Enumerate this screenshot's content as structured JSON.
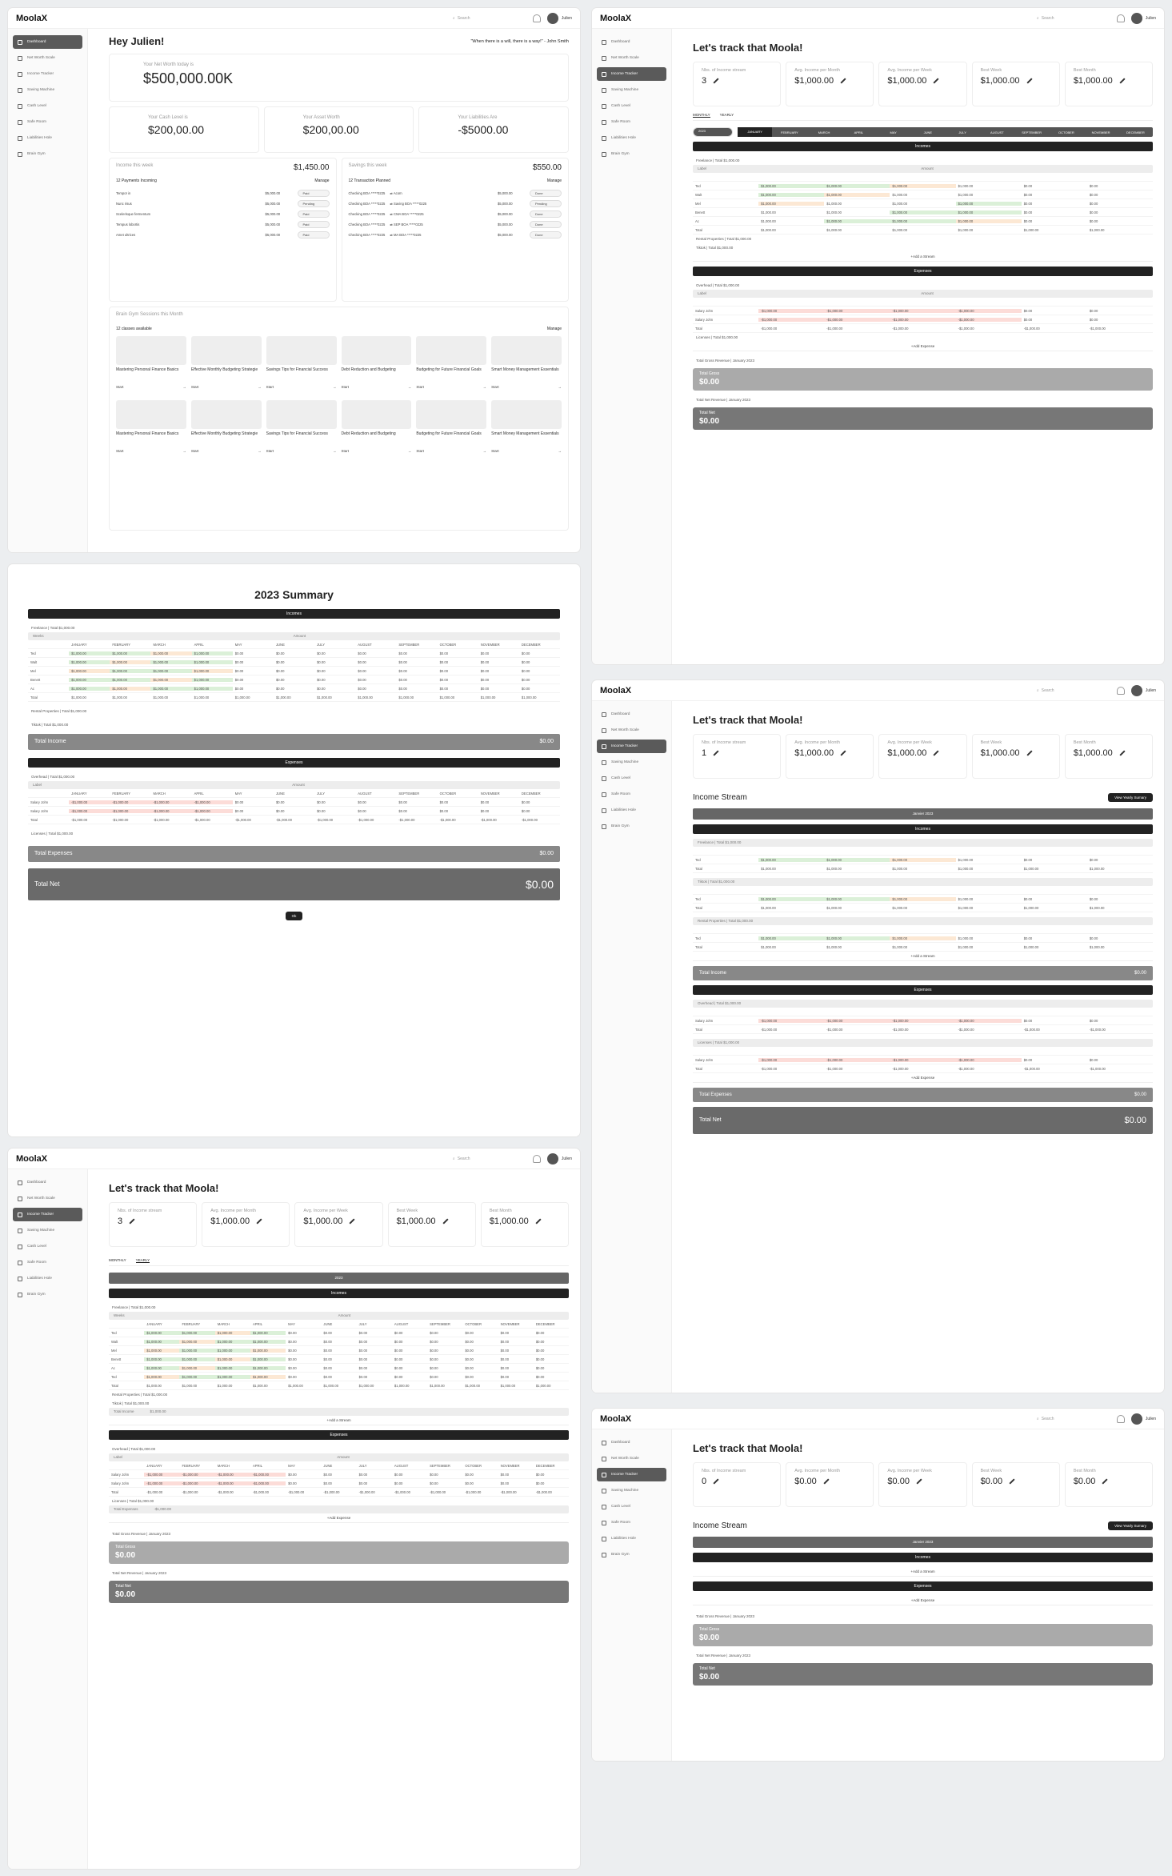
{
  "app": {
    "logo": "MoolaX",
    "search": "Search",
    "user": "Julien"
  },
  "nav": [
    "Dashboard",
    "Net Worth Scale",
    "Income Tracker",
    "Saving Machine",
    "Cash Level",
    "Safe Room",
    "Liabilities Hole",
    "Brain Gym"
  ],
  "dash": {
    "greet": "Hey Julien!",
    "quote": "\"When there is a will, there is a way!\" - John Smith",
    "nw_label": "Your Net Worth today is",
    "nw": "$500,000.00K",
    "cash_l": "Your Cash Level is",
    "cash": "$200,00.00",
    "asset_l": "Your Asset Worth",
    "asset": "$200,00.00",
    "liab_l": "Your Liabilities Are",
    "liab": "-$5000.00",
    "inc_l": "Income this week",
    "inc": "$1,450.00",
    "inc_sub": "12 Payments Incoming",
    "sav_l": "Savings this week",
    "sav": "$550.00",
    "sav_sub": "12 Transaction Planned",
    "manage": "Manage",
    "payments": [
      [
        "Tempor in",
        "$5,000.00",
        "Paid"
      ],
      [
        "Nunc risus",
        "$5,000.00",
        "Pending"
      ],
      [
        "Scelerisque fermentum",
        "$5,000.00",
        "Paid"
      ],
      [
        "Tempus lobortis",
        "$5,000.00",
        "Paid"
      ],
      [
        "Amet ultrices",
        "$5,000.00",
        "Paid"
      ]
    ],
    "transfers": [
      [
        "Checking BOA *****0225",
        "Acorn",
        "$5,000.00",
        "Done"
      ],
      [
        "Checking BOA *****0225",
        "Saving BOA *****0225",
        "$5,000.00",
        "Pending"
      ],
      [
        "Checking BOA *****0225",
        "CMA BOA *****0225",
        "$5,000.00",
        "Done"
      ],
      [
        "Checking BOA *****0225",
        "SEP BOA *****0225",
        "$5,000.00",
        "Done"
      ],
      [
        "Checking BOA *****0225",
        "MA BOA *****0225",
        "$5,000.00",
        "Done"
      ]
    ],
    "gym_l": "Brain Gym Sessions this Month",
    "gym_sub": "12 classes available",
    "courses": [
      "Mastering Personal Finance Basics",
      "Effective Monthly Budgeting Strategie",
      "Savings Tips for Financial Success",
      "Debt Reduction and Budgeting",
      "Budgeting for Future Financial Goals",
      "Smart Money Management Essentials"
    ],
    "start": "Start"
  },
  "tracker": {
    "title": "Let's track that Moola!",
    "stats": [
      [
        "Nbs. of Income stream",
        "3"
      ],
      [
        "Avg. Income per Month",
        "$1,000.00"
      ],
      [
        "Avg. Income per Week",
        "$1,000.00"
      ],
      [
        "Best Week",
        "$1,000.00"
      ],
      [
        "Best Month",
        "$1,000.00"
      ]
    ],
    "stats2": [
      [
        "Nbs. of Income stream",
        "1"
      ],
      [
        "Avg. Income per Month",
        "$1,000.00"
      ],
      [
        "Avg. Income per Week",
        "$1,000.00"
      ],
      [
        "Best Week",
        "$1,000.00"
      ],
      [
        "Best Month",
        "$1,000.00"
      ]
    ],
    "stats3": [
      [
        "Nbs. of Income stream",
        "0"
      ],
      [
        "Avg. Income per Month",
        "$0.00"
      ],
      [
        "Avg. Income per Week",
        "$0.00"
      ],
      [
        "Best Week",
        "$0.00"
      ],
      [
        "Best Month",
        "$0.00"
      ]
    ],
    "monthly": "MONTHLY",
    "yearly": "YEARLY",
    "year": "2023",
    "months": [
      "JANUARY",
      "FEBRUARY",
      "MARCH",
      "APRIL",
      "MAY",
      "JUNE",
      "JULY",
      "AUGUST",
      "SEPTEMBER",
      "OCTOBER",
      "NOVEMBER",
      "DECEMBER"
    ],
    "incomes": "Incomes",
    "expenses": "Expenses",
    "freelance": "Freelance  |  Total $1,000.00",
    "rental": "Rental Properties  |  Total $1,000.00",
    "tiktok": "Tiktok  |  Total $1,000.00",
    "overhead": "Overhead  |  Total $1,000.00",
    "licenses": "Licenses  |  Total $1,000.00",
    "label": "Label",
    "amount": "Amount",
    "total": "Total",
    "weeks": "Weeks",
    "add_stream": "+Add a Stream",
    "add_expense": "+Add Expense",
    "gross": "Total Gross Revenue | January 2023",
    "gross_v": "$0.00",
    "gross_t": "Total Gross",
    "net": "Total Net Revenue | January 2023",
    "net_v": "$0.00",
    "net_t": "Total Net",
    "stream_title": "Income Stream",
    "yearly_btn": "View Yearly Sumary",
    "period": "Janvier 2023",
    "total_income": "Total Income",
    "total_expenses": "Total Expenses",
    "total_net": "Total Net",
    "zero": "$0.00",
    "amt": "$1,000.00",
    "neg": "-$1,000.00"
  },
  "summary": {
    "title": "2023 Summary",
    "ok": "Ok",
    "rows": [
      "Ted",
      "Walt",
      "Mel",
      "Benett",
      "Ac"
    ],
    "exp_rows": [
      "Salary John",
      "Salary John"
    ]
  }
}
